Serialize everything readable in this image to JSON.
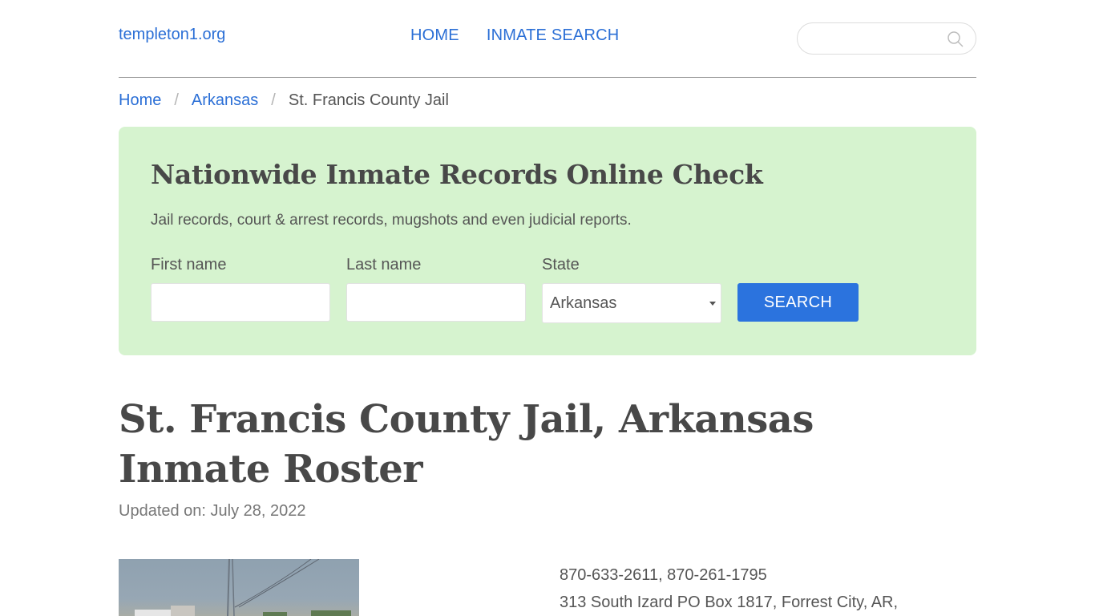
{
  "header": {
    "brand": "templeton1.org",
    "nav": [
      "HOME",
      "INMATE SEARCH"
    ],
    "search_placeholder": ""
  },
  "breadcrumb": {
    "items": [
      "Home",
      "Arkansas"
    ],
    "current": "St. Francis County Jail",
    "separator": "/"
  },
  "promo": {
    "title": "Nationwide Inmate Records Online Check",
    "subtitle": "Jail records, court & arrest records, mugshots and even judicial reports.",
    "first_name_label": "First name",
    "first_name_value": "",
    "last_name_label": "Last name",
    "last_name_value": "",
    "state_label": "State",
    "state_value": "Arkansas",
    "search_button": "SEARCH"
  },
  "main": {
    "title": "St. Francis County Jail, Arkansas Inmate Roster",
    "updated": "Updated on: July 28, 2022",
    "phones": "870-633-2611, 870-261-1795",
    "address": "313 South Izard PO Box 1817, Forrest City, AR,"
  },
  "colors": {
    "link": "#2b6fd6",
    "promo_bg": "#d6f3cf",
    "button": "#2b73de"
  }
}
